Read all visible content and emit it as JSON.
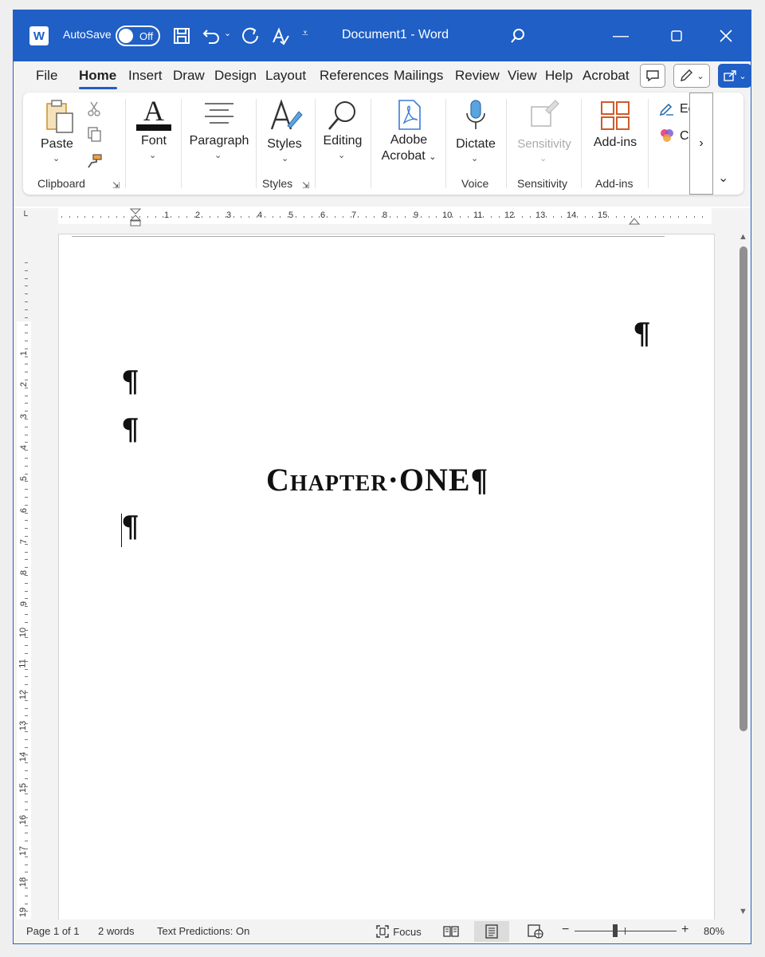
{
  "titlebar": {
    "app_icon": "word-logo-icon",
    "app_icon_letter": "W",
    "autosave_label": "AutoSave",
    "autosave_state": "Off",
    "doc_title": "Document1  -  Word",
    "accent": "#1f5fc6"
  },
  "tabs": {
    "items": [
      "File",
      "Home",
      "Insert",
      "Draw",
      "Design",
      "Layout",
      "References",
      "Mailings",
      "Review",
      "View",
      "Help",
      "Acrobat"
    ],
    "active": "Home"
  },
  "ribbon": {
    "clipboard": {
      "paste_label": "Paste",
      "group_label": "Clipboard"
    },
    "font": {
      "label": "Font",
      "icon_letter": "A"
    },
    "paragraph": {
      "label": "Paragraph"
    },
    "styles": {
      "label": "Styles",
      "group_label": "Styles"
    },
    "editing": {
      "label": "Editing"
    },
    "adobe": {
      "line1": "Adobe",
      "line2": "Acrobat"
    },
    "voice": {
      "dictate_label": "Dictate",
      "group_label": "Voice"
    },
    "sensitivity": {
      "label": "Sensitivity",
      "group_label": "Sensitivity"
    },
    "addins": {
      "label": "Add-ins",
      "group_label": "Add-ins"
    },
    "extra": {
      "edit_label": "Edit",
      "copilot_label": "Cop"
    },
    "overflow_glyph": "›"
  },
  "ruler": {
    "h_numbers": [
      "1",
      "2",
      "3",
      "4",
      "5",
      "6",
      "7",
      "8",
      "9",
      "10",
      "11",
      "12",
      "13",
      "14",
      "15"
    ],
    "v_numbers": [
      "1",
      "2",
      "3",
      "4",
      "5",
      "6",
      "7",
      "8",
      "9",
      "10",
      "11",
      "12",
      "13",
      "14",
      "15",
      "16",
      "17",
      "18",
      "19"
    ]
  },
  "document": {
    "pilcrow": "¶",
    "chapter_text": "Chapter·ONE¶"
  },
  "statusbar": {
    "page": "Page 1 of 1",
    "words": "2 words",
    "predictions": "Text Predictions: On",
    "focus": "Focus",
    "zoom_level": "80%",
    "zoom_minus": "−",
    "zoom_plus": "+"
  }
}
